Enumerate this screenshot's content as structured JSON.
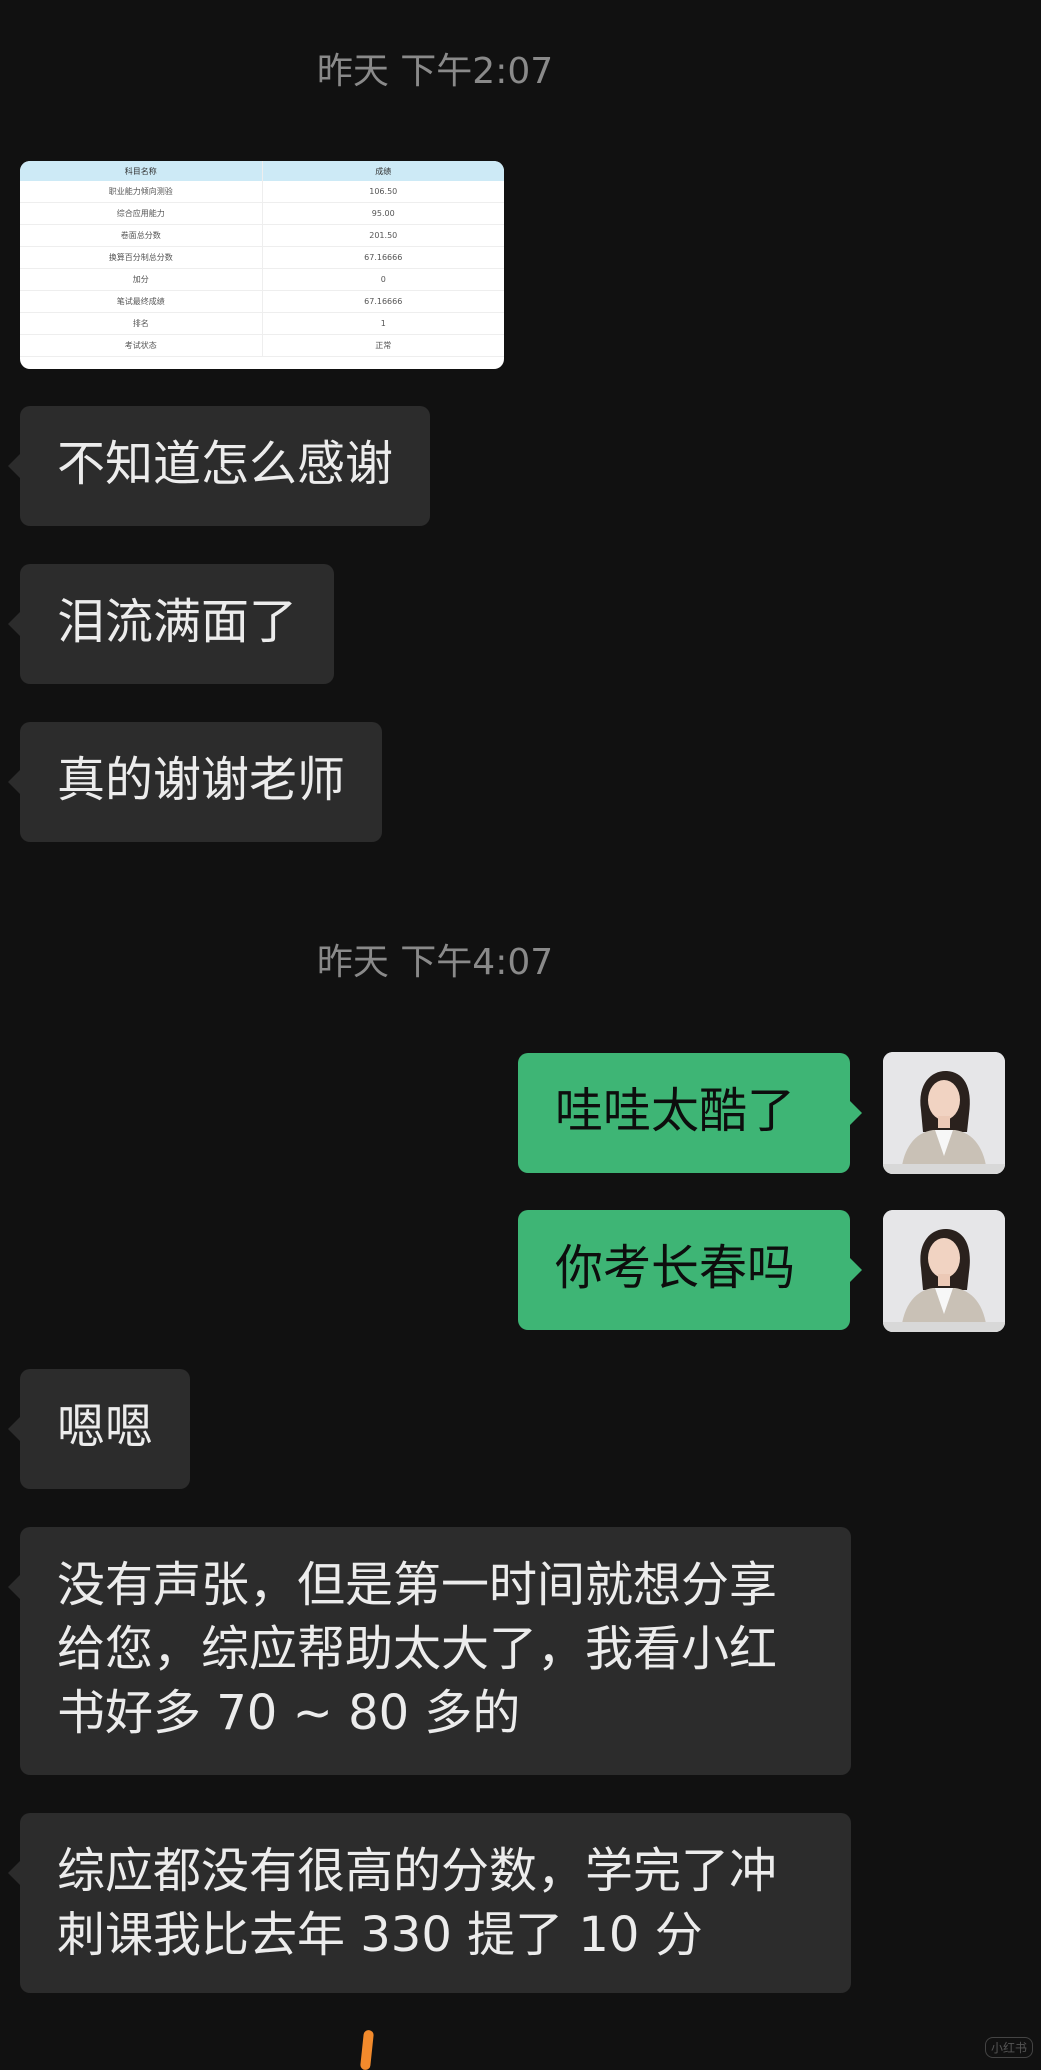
{
  "chat": {
    "timestamp_1": "昨天 下午2:07",
    "timestamp_2": "昨天 下午4:07",
    "score_table": {
      "headers": [
        "科目名称",
        "成绩"
      ],
      "rows": [
        [
          "职业能力倾向测验",
          "106.50"
        ],
        [
          "综合应用能力",
          "95.00"
        ],
        [
          "卷面总分数",
          "201.50"
        ],
        [
          "换算百分制总分数",
          "67.16666"
        ],
        [
          "加分",
          "0"
        ],
        [
          "笔试最终成绩",
          "67.16666"
        ],
        [
          "排名",
          "1"
        ],
        [
          "考试状态",
          "正常"
        ]
      ]
    },
    "messages": [
      {
        "side": "in",
        "text": "不知道怎么感谢"
      },
      {
        "side": "in",
        "text": "泪流满面了"
      },
      {
        "side": "in",
        "text": "真的谢谢老师"
      },
      {
        "side": "out",
        "text": "哇哇太酷了"
      },
      {
        "side": "out",
        "text": "你考长春吗"
      },
      {
        "side": "in",
        "text": "嗯嗯"
      },
      {
        "side": "in",
        "text": "没有声张，但是第一时间就想分享给您，综应帮助太大了，我看小红书好多 70 ~ 80 多的"
      },
      {
        "side": "in",
        "text": "综应都没有很高的分数，学完了冲刺课我比去年 330 提了 10 分"
      }
    ],
    "watermark": "小红书"
  },
  "colors": {
    "background": "#111111",
    "incoming_bubble": "#2c2c2c",
    "outgoing_bubble": "#3eb575",
    "timestamp_text": "#8a8a8a"
  }
}
